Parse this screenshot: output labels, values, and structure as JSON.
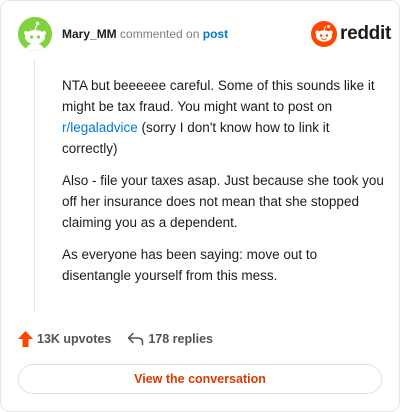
{
  "header": {
    "username": "Mary_MM",
    "commented_text": "commented on",
    "post_link": "post",
    "brand": "reddit"
  },
  "comment": {
    "p1_before": "NTA but beeeeee careful. Some of this sounds like it might be tax fraud. You might want to post on ",
    "p1_link": "r/legaladvice",
    "p1_after": " (sorry I don't know how to link it correctly)",
    "p2": "Also - file your taxes asap. Just because she took you off her insurance does not mean that she stopped claiming you as a dependent.",
    "p3": "As everyone has been saying: move out to disentangle yourself from this mess."
  },
  "stats": {
    "upvotes": "13K upvotes",
    "replies": "178 replies"
  },
  "cta": {
    "label": "View the conversation"
  },
  "colors": {
    "reddit_orange": "#ff4500",
    "link_blue": "#0079d3",
    "avatar_green": "#7fd33f",
    "cta_orange": "#d93a00"
  },
  "icons": [
    "snoo-avatar-icon",
    "reddit-logo-icon",
    "upvote-arrow-icon",
    "reply-arrow-icon"
  ]
}
